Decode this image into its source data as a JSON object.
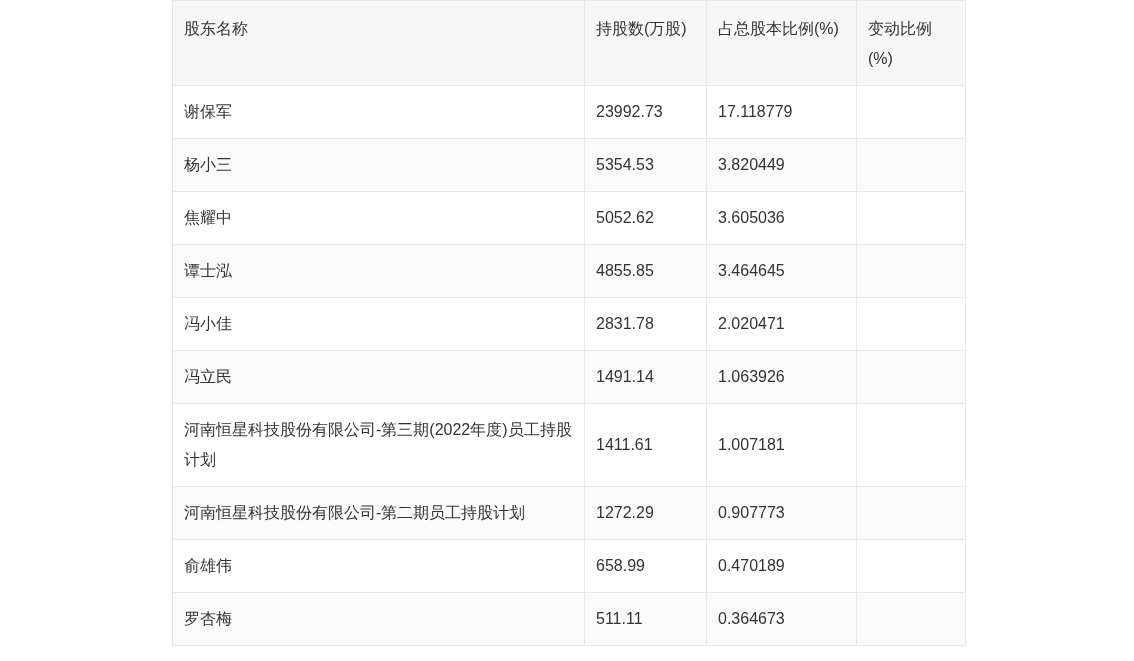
{
  "table": {
    "columns": [
      "股东名称",
      "持股数(万股)",
      "占总股本比例(%)",
      "变动比例(%)"
    ],
    "rows": [
      {
        "name": "谢保军",
        "shares": "23992.73",
        "ratio": "17.118779"
      },
      {
        "name": "杨小三",
        "shares": "5354.53",
        "ratio": "3.820449"
      },
      {
        "name": "焦耀中",
        "shares": "5052.62",
        "ratio": "3.605036"
      },
      {
        "name": "谭士泓",
        "shares": "4855.85",
        "ratio": "3.464645"
      },
      {
        "name": "冯小佳",
        "shares": "2831.78",
        "ratio": "2.020471"
      },
      {
        "name": "冯立民",
        "shares": "1491.14",
        "ratio": "1.063926"
      },
      {
        "name": "河南恒星科技股份有限公司-第三期(2022年度)员工持股计划",
        "shares": "1411.61",
        "ratio": "1.007181"
      },
      {
        "name": "河南恒星科技股份有限公司-第二期员工持股计划",
        "shares": "1272.29",
        "ratio": "0.907773"
      },
      {
        "name": "俞雄伟",
        "shares": "658.99",
        "ratio": "0.470189"
      },
      {
        "name": "罗杏梅",
        "shares": "511.11",
        "ratio": "0.364673"
      }
    ]
  }
}
